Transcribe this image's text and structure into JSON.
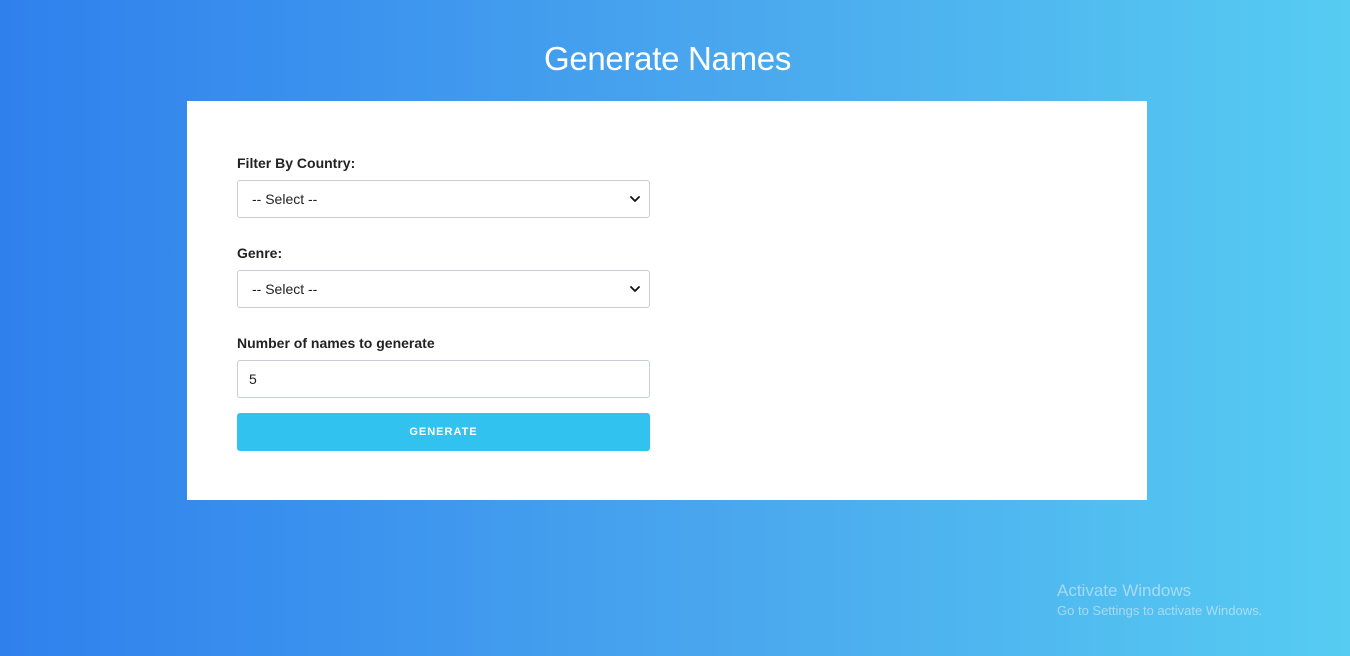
{
  "page": {
    "title": "Generate Names"
  },
  "form": {
    "country": {
      "label": "Filter By Country:",
      "selected": "-- Select --"
    },
    "genre": {
      "label": "Genre:",
      "selected": "-- Select --"
    },
    "count": {
      "label": "Number of names to generate",
      "value": "5"
    },
    "generate_label": "GENERATE"
  },
  "watermark": {
    "title": "Activate Windows",
    "subtitle": "Go to Settings to activate Windows."
  },
  "colors": {
    "background_start": "#2f80ed",
    "background_end": "#56ccf2",
    "button": "#31c2ef"
  },
  "icons": {
    "select_arrow": "chevron-down-icon"
  }
}
